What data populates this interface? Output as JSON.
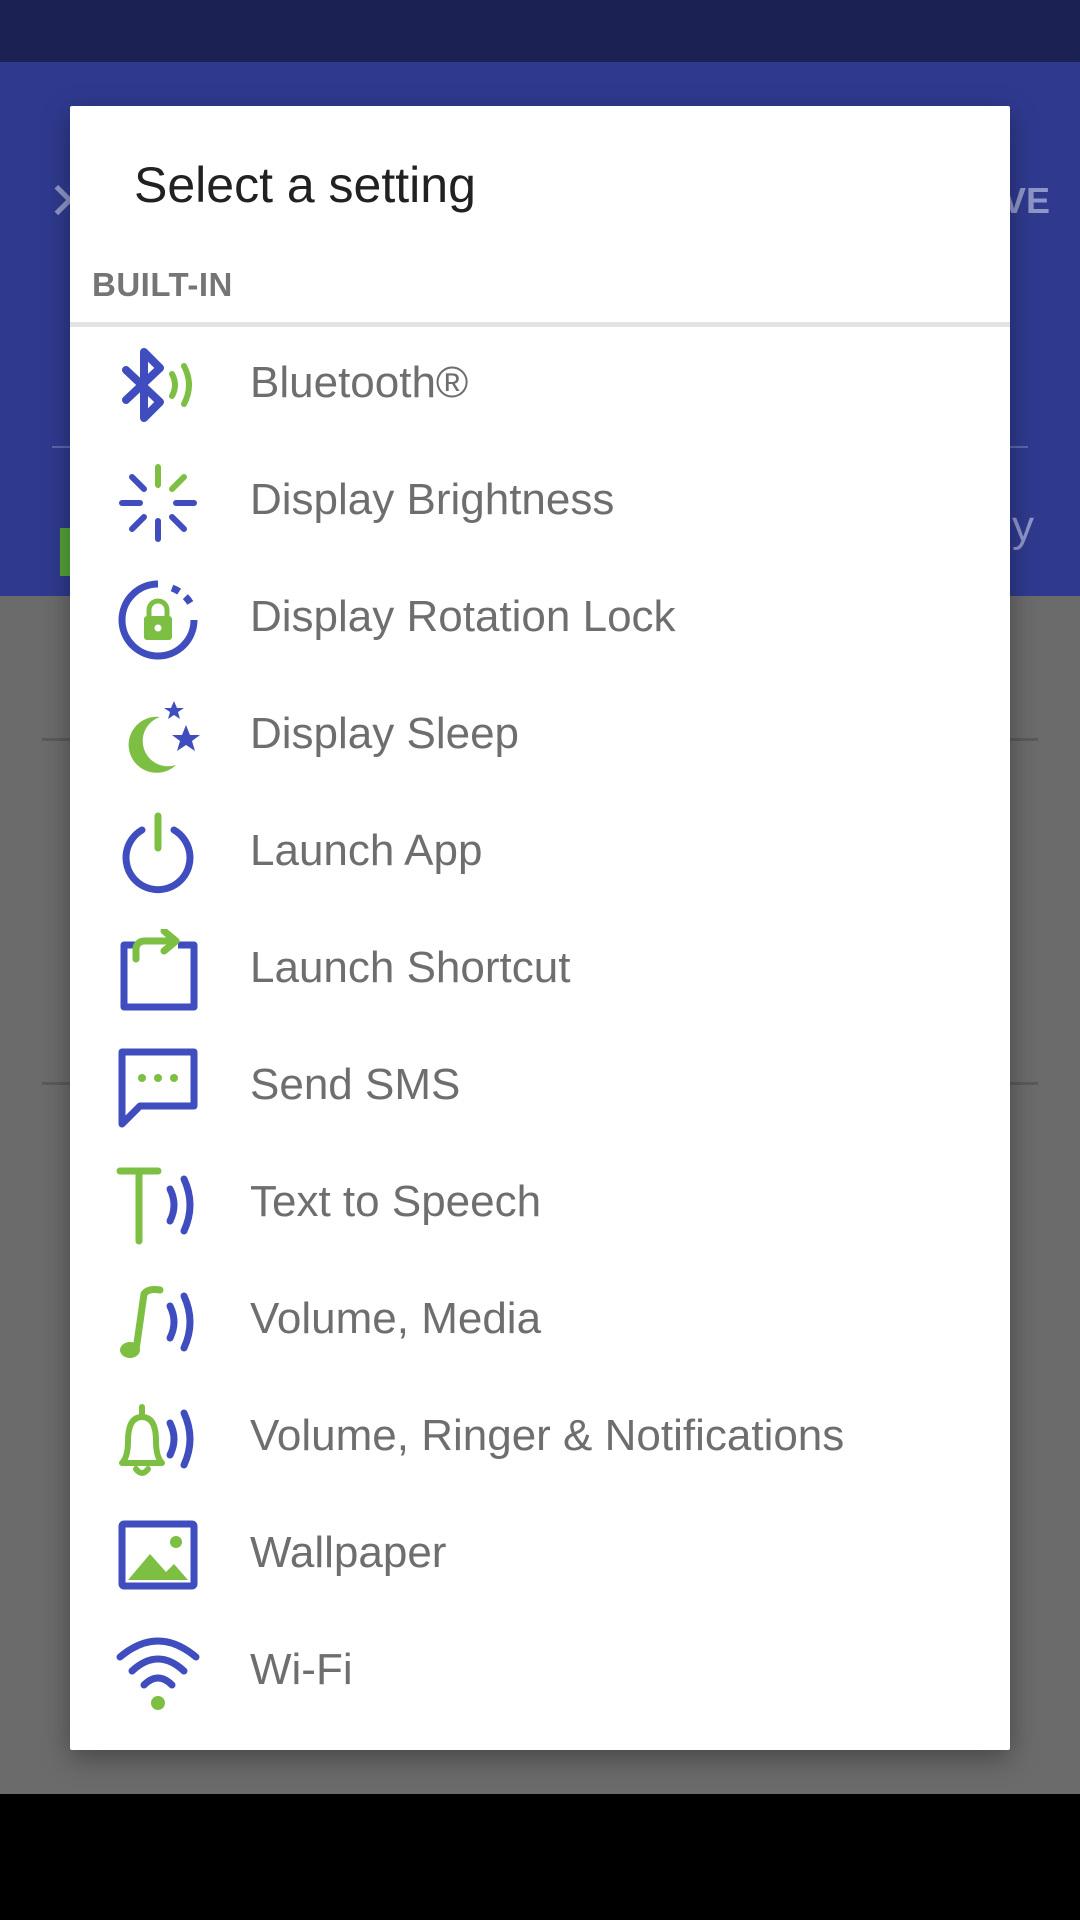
{
  "background": {
    "save_label": "VE",
    "close_icon": "close-icon",
    "peek_text": "y"
  },
  "dialog": {
    "title": "Select a setting",
    "section": "BUILT-IN",
    "items": [
      {
        "label": "Bluetooth®",
        "icon": "bluetooth-icon"
      },
      {
        "label": "Display Brightness",
        "icon": "brightness-icon"
      },
      {
        "label": "Display Rotation Lock",
        "icon": "rotation-lock-icon"
      },
      {
        "label": "Display Sleep",
        "icon": "sleep-moon-icon"
      },
      {
        "label": "Launch App",
        "icon": "power-icon"
      },
      {
        "label": "Launch Shortcut",
        "icon": "shortcut-icon"
      },
      {
        "label": "Send SMS",
        "icon": "sms-icon"
      },
      {
        "label": "Text to Speech",
        "icon": "text-to-speech-icon"
      },
      {
        "label": "Volume, Media",
        "icon": "music-volume-icon"
      },
      {
        "label": "Volume, Ringer & Notifications",
        "icon": "bell-volume-icon"
      },
      {
        "label": "Wallpaper",
        "icon": "wallpaper-icon"
      },
      {
        "label": "Wi-Fi",
        "icon": "wifi-icon"
      }
    ]
  },
  "colors": {
    "blue": "#3f4dbf",
    "green": "#7dbf42",
    "appbar": "#2f3a8f",
    "statusbar": "#1b2152"
  }
}
